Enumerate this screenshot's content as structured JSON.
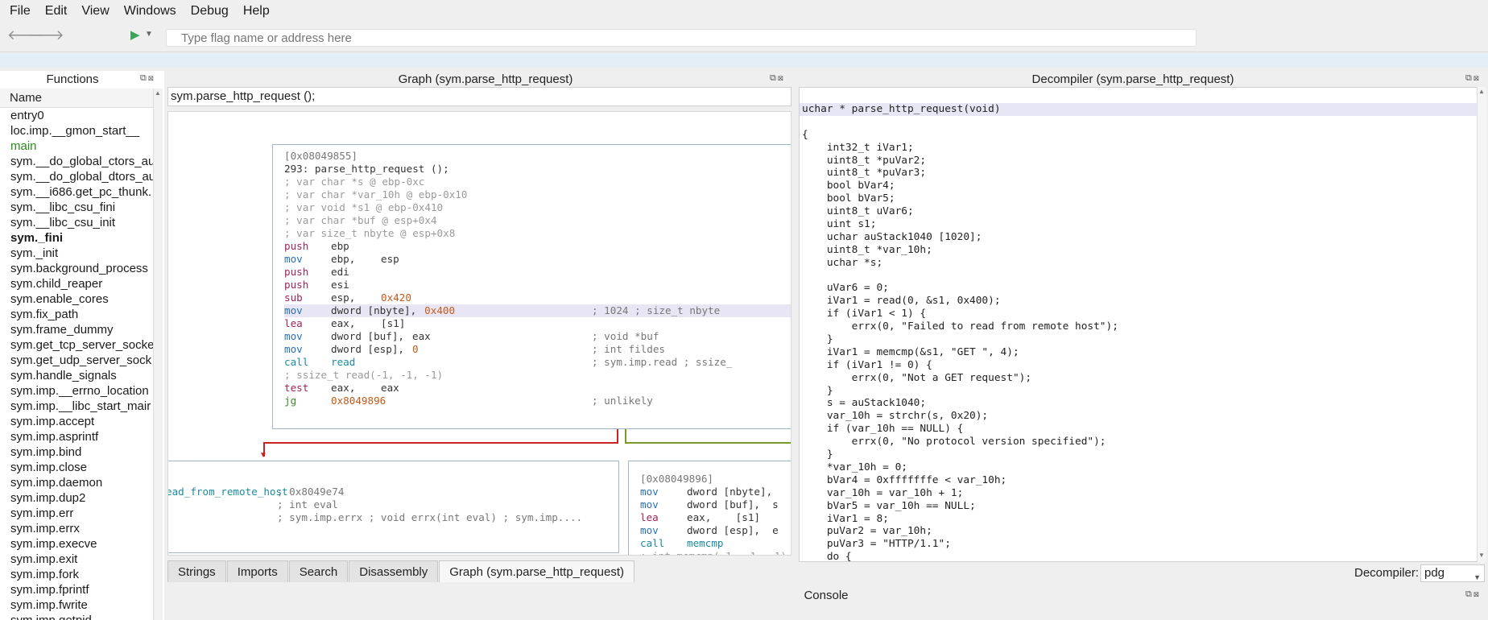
{
  "menu": [
    "File",
    "Edit",
    "View",
    "Windows",
    "Debug",
    "Help"
  ],
  "toolbar": {
    "back_icon": "back-arrow-icon",
    "forward_icon": "forward-arrow-icon",
    "run_icon": "play-icon",
    "flag_placeholder": "Type flag name or address here"
  },
  "functions": {
    "title": "Functions",
    "column": "Name",
    "items": [
      "entry0",
      "loc.imp.__gmon_start__",
      "main",
      "sym.__do_global_ctors_au",
      "sym.__do_global_dtors_au",
      "sym.__i686.get_pc_thunk.",
      "sym.__libc_csu_fini",
      "sym.__libc_csu_init",
      "sym._fini",
      "sym._init",
      "sym.background_process",
      "sym.child_reaper",
      "sym.enable_cores",
      "sym.fix_path",
      "sym.frame_dummy",
      "sym.get_tcp_server_socke",
      "sym.get_udp_server_sock",
      "sym.handle_signals",
      "sym.imp.__errno_location",
      "sym.imp.__libc_start_mair",
      "sym.imp.accept",
      "sym.imp.asprintf",
      "sym.imp.bind",
      "sym.imp.close",
      "sym.imp.daemon",
      "sym.imp.dup2",
      "sym.imp.err",
      "sym.imp.errx",
      "sym.imp.execve",
      "sym.imp.exit",
      "sym.imp.fork",
      "sym.imp.fprintf",
      "sym.imp.fwrite",
      "sym.imp.getpid"
    ]
  },
  "graph": {
    "title": "Graph (sym.parse_http_request)",
    "signature": "sym.parse_http_request ();",
    "main_block": [
      {
        "t": "[0x08049855]",
        "c": "addr"
      },
      {
        "t": "293: parse_http_request ();",
        "c": "head"
      },
      {
        "t": "; var char *s @ ebp-0xc",
        "c": "var"
      },
      {
        "t": "; var char *var_10h @ ebp-0x10",
        "c": "var"
      },
      {
        "t": "; var void *s1 @ ebp-0x410",
        "c": "var"
      },
      {
        "t": "; var char *buf @ esp+0x4",
        "c": "var"
      },
      {
        "t": "; var size_t nbyte @ esp+0x8",
        "c": "var"
      }
    ],
    "instructions": [
      {
        "mn": "push",
        "op1": "ebp",
        "op2": "",
        "cmt": "",
        "k": "mn"
      },
      {
        "mn": "mov",
        "op1": "ebp,",
        "op2": "esp",
        "cmt": "",
        "k": "mv"
      },
      {
        "mn": "push",
        "op1": "edi",
        "op2": "",
        "cmt": "",
        "k": "mn"
      },
      {
        "mn": "push",
        "op1": "esi",
        "op2": "",
        "cmt": "",
        "k": "mn"
      },
      {
        "mn": "sub",
        "op1": "esp,",
        "op2": "0x420",
        "cmt": "",
        "k": "mn"
      },
      {
        "mn": "mov",
        "op1": "dword [nbyte],",
        "op2": "0x400",
        "cmt": "; 1024 ; size_t nbyte",
        "k": "mv"
      },
      {
        "mn": "lea",
        "op1": "eax,",
        "op2": "[s1]",
        "cmt": "",
        "k": "mn"
      },
      {
        "mn": "mov",
        "op1": "dword [buf],",
        "op2": "eax",
        "cmt": "; void *buf",
        "k": "mv"
      },
      {
        "mn": "mov",
        "op1": "dword [esp],",
        "op2": "0",
        "cmt": "; int fildes",
        "k": "mv"
      },
      {
        "mn": "call",
        "op1": "read",
        "op2": "",
        "cmt": "; sym.imp.read ; ssize_",
        "k": "call"
      },
      {
        "mn": "; ssize_t read(-1, -1, -1)",
        "op1": "",
        "op2": "",
        "cmt": "",
        "k": "grey"
      },
      {
        "mn": "test",
        "op1": "eax,",
        "op2": "eax",
        "cmt": "",
        "k": "mn"
      },
      {
        "mn": "jg",
        "op1": "0x8049896",
        "op2": "",
        "cmt": "; unlikely",
        "k": "jmp"
      }
    ],
    "left_block": [
      {
        "a": "ead_from_remote_host",
        "b": "; 0x8049e74"
      },
      {
        "a": "",
        "b": "; int eval"
      },
      {
        "a": "",
        "b": "; sym.imp.errx ; void errx(int eval) ; sym.imp...."
      }
    ],
    "right_block_addr": "[0x08049896]",
    "right_block": [
      {
        "mn": "mov",
        "op": "dword [nbyte],",
        "k": "mv"
      },
      {
        "mn": "mov",
        "op": "dword [buf],  s",
        "k": "mv"
      },
      {
        "mn": "lea",
        "op": "eax,    [s1]",
        "k": "mn"
      },
      {
        "mn": "mov",
        "op": "dword [esp],  e",
        "k": "mv"
      },
      {
        "mn": "call",
        "op": "memcmp",
        "k": "call"
      },
      {
        "mn": "; int memcmp(-1, -1, -1)",
        "op": "",
        "k": "grey"
      }
    ]
  },
  "tabs": [
    "Strings",
    "Imports",
    "Search",
    "Disassembly",
    "Graph (sym.parse_http_request)"
  ],
  "decompiler": {
    "title": "Decompiler (sym.parse_http_request)",
    "lines": [
      "uchar * parse_http_request(void)",
      "",
      "{",
      "    int32_t iVar1;",
      "    uint8_t *puVar2;",
      "    uint8_t *puVar3;",
      "    bool bVar4;",
      "    bool bVar5;",
      "    uint8_t uVar6;",
      "    uint s1;",
      "    uchar auStack1040 [1020];",
      "    uint8_t *var_10h;",
      "    uchar *s;",
      "",
      "    uVar6 = 0;",
      "    iVar1 = read(0, &s1, 0x400);",
      "    if (iVar1 < 1) {",
      "        errx(0, \"Failed to read from remote host\");",
      "    }",
      "    iVar1 = memcmp(&s1, \"GET \", 4);",
      "    if (iVar1 != 0) {",
      "        errx(0, \"Not a GET request\");",
      "    }",
      "    s = auStack1040;",
      "    var_10h = strchr(s, 0x20);",
      "    if (var_10h == NULL) {",
      "        errx(0, \"No protocol version specified\");",
      "    }",
      "    *var_10h = 0;",
      "    bVar4 = 0xfffffffe < var_10h;",
      "    var_10h = var_10h + 1;",
      "    bVar5 = var_10h == NULL;",
      "    iVar1 = 8;",
      "    puVar2 = var_10h;",
      "    puVar3 = \"HTTP/1.1\";",
      "    do {"
    ],
    "footer_label": "Decompiler:",
    "footer_value": "pdg"
  },
  "console": {
    "title": "Console"
  }
}
